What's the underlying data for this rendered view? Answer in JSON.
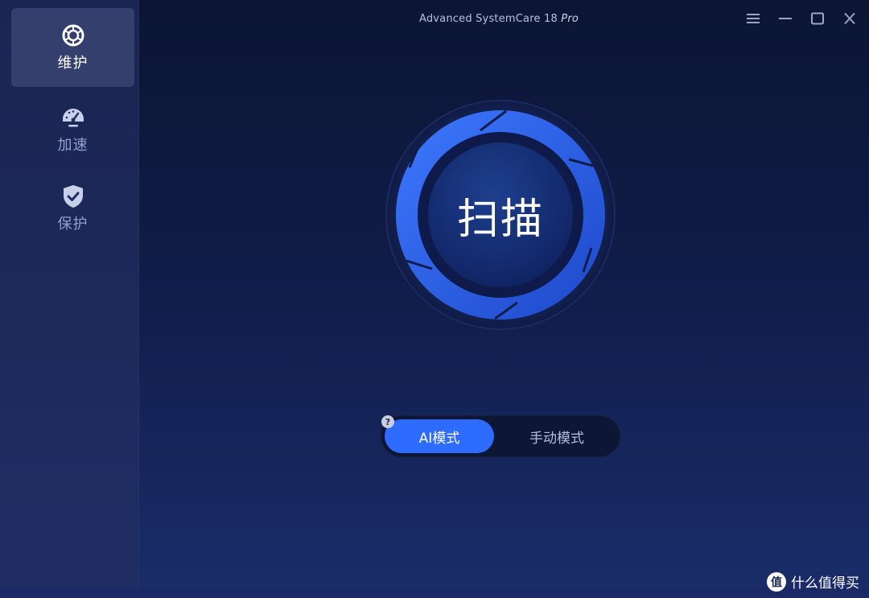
{
  "window": {
    "title": "Advanced SystemCare 18",
    "title_edition": "Pro",
    "controls": [
      "menu-icon",
      "minimize-icon",
      "maximize-icon",
      "close-icon"
    ]
  },
  "sidebar": {
    "items": [
      {
        "label": "维护",
        "icon": "maintenance-icon",
        "active": true
      },
      {
        "label": "加速",
        "icon": "speedometer-icon",
        "active": false
      },
      {
        "label": "保护",
        "icon": "shield-check-icon",
        "active": false
      }
    ]
  },
  "scan": {
    "label": "扫描"
  },
  "mode": {
    "help": "?",
    "ai_label": "AI模式",
    "manual_label": "手动模式",
    "selected": "AI模式"
  },
  "watermark": {
    "logo_text": "值",
    "text": "什么值得买"
  },
  "colors": {
    "accent": "#2e6bff",
    "background": "#0c1534",
    "sidebar": "#1b2552",
    "sidebar_active": "#343f6e",
    "ring": "#2b5be8"
  }
}
